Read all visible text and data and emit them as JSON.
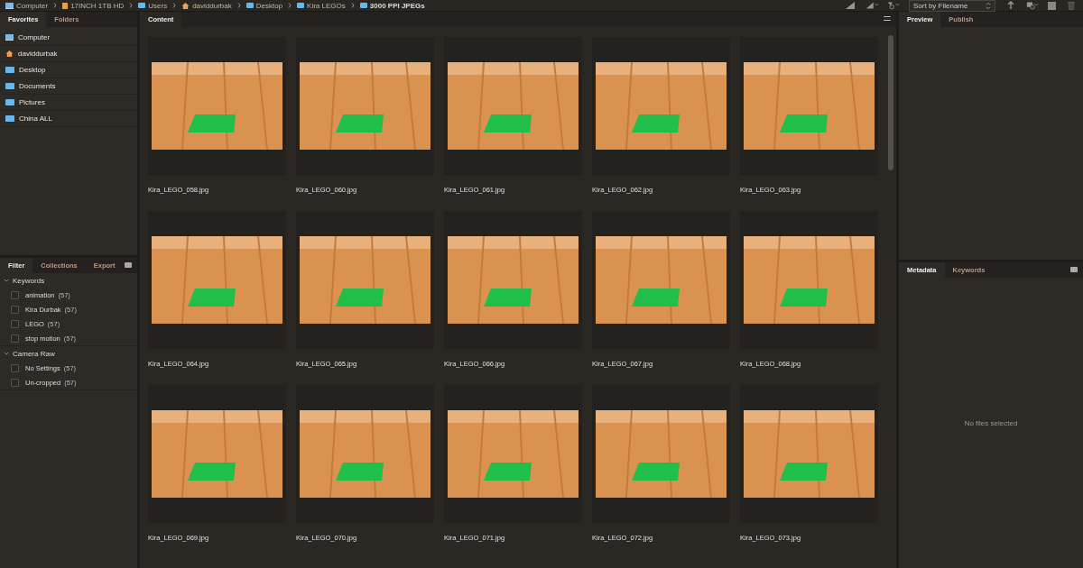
{
  "path_bar": [
    {
      "label": "Computer",
      "kind": "computer"
    },
    {
      "label": "17INCH 1TB HD",
      "kind": "drive"
    },
    {
      "label": "Users",
      "kind": "folder"
    },
    {
      "label": "daviddurbak",
      "kind": "home"
    },
    {
      "label": "Desktop",
      "kind": "folder"
    },
    {
      "label": "Kira LEGOs",
      "kind": "folder"
    },
    {
      "label": "3000 PPI JPEGs",
      "kind": "folder"
    }
  ],
  "toolbar": {
    "sort": "Sort by Filename"
  },
  "favorites_panel": {
    "tabs": [
      {
        "label": "Favorites",
        "selected": true
      },
      {
        "label": "Folders",
        "selected": false
      }
    ],
    "items": [
      {
        "label": "Computer",
        "kind": "computer"
      },
      {
        "label": "daviddurbak",
        "kind": "home"
      },
      {
        "label": "Desktop",
        "kind": "folder"
      },
      {
        "label": "Documents",
        "kind": "folder"
      },
      {
        "label": "Pictures",
        "kind": "folder"
      },
      {
        "label": "China ALL",
        "kind": "folder"
      }
    ]
  },
  "filter_panel": {
    "tabs": [
      {
        "label": "Filter",
        "selected": true
      },
      {
        "label": "Collections",
        "selected": false
      },
      {
        "label": "Export",
        "selected": false
      }
    ],
    "groups": [
      {
        "label": "Keywords",
        "expanded": true,
        "items": [
          {
            "label": "animation",
            "count": "(57)",
            "checked": false
          },
          {
            "label": "Kira Durbak",
            "count": "(57)",
            "checked": false
          },
          {
            "label": "LEGO",
            "count": "(57)",
            "checked": false
          },
          {
            "label": "stop motion",
            "count": "(57)",
            "checked": false
          }
        ]
      },
      {
        "label": "Camera Raw",
        "expanded": true,
        "items": [
          {
            "label": "No Settings",
            "count": "(57)",
            "checked": false
          },
          {
            "label": "Un-cropped",
            "count": "(57)",
            "checked": false
          }
        ]
      }
    ]
  },
  "content": {
    "tabs": [
      {
        "label": "Content",
        "selected": true
      }
    ],
    "files": [
      {
        "name": "Kira_LEGO_058.jpg"
      },
      {
        "name": "Kira_LEGO_060.jpg"
      },
      {
        "name": "Kira_LEGO_061.jpg"
      },
      {
        "name": "Kira_LEGO_062.jpg"
      },
      {
        "name": "Kira_LEGO_063.jpg"
      },
      {
        "name": "Kira_LEGO_064.jpg"
      },
      {
        "name": "Kira_LEGO_065.jpg"
      },
      {
        "name": "Kira_LEGO_066.jpg"
      },
      {
        "name": "Kira_LEGO_067.jpg"
      },
      {
        "name": "Kira_LEGO_068.jpg"
      },
      {
        "name": "Kira_LEGO_069.jpg"
      },
      {
        "name": "Kira_LEGO_070.jpg"
      },
      {
        "name": "Kira_LEGO_071.jpg"
      },
      {
        "name": "Kira_LEGO_072.jpg"
      },
      {
        "name": "Kira_LEGO_073.jpg"
      }
    ]
  },
  "preview_panel": {
    "tabs": [
      {
        "label": "Preview",
        "selected": true
      },
      {
        "label": "Publish",
        "selected": false
      }
    ]
  },
  "metadata_panel": {
    "tabs": [
      {
        "label": "Metadata",
        "selected": true
      },
      {
        "label": "Keywords",
        "selected": false
      }
    ],
    "message": "No files selected"
  }
}
